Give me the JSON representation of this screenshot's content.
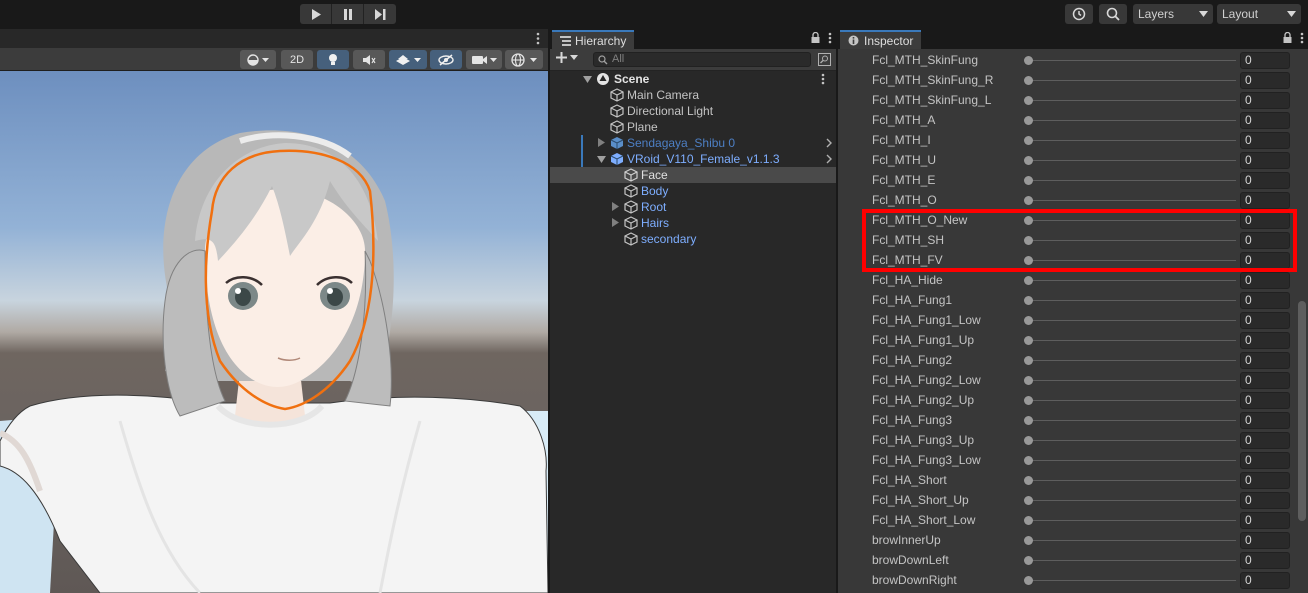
{
  "toolbar": {
    "layers_label": "Layers",
    "layout_label": "Layout"
  },
  "scene_tools": {
    "mode_2d": "2D"
  },
  "hierarchy": {
    "title": "Hierarchy",
    "search_placeholder": "All",
    "items": [
      {
        "label": "Scene",
        "depth": 0,
        "color": "#e4e4e4",
        "bold": true
      },
      {
        "label": "Main Camera",
        "depth": 1,
        "color": "#c4c4c4"
      },
      {
        "label": "Directional Light",
        "depth": 1,
        "color": "#c4c4c4"
      },
      {
        "label": "Plane",
        "depth": 1,
        "color": "#c4c4c4"
      },
      {
        "label": "Sendagaya_Shibu 0",
        "depth": 1,
        "color": "#4d7fc4"
      },
      {
        "label": "VRoid_V110_Female_v1.1.3",
        "depth": 1,
        "color": "#7eaeff"
      },
      {
        "label": "Face",
        "depth": 2,
        "color": "#c4c4c4"
      },
      {
        "label": "Body",
        "depth": 2,
        "color": "#7eaeff"
      },
      {
        "label": "Root",
        "depth": 2,
        "color": "#7eaeff"
      },
      {
        "label": "Hairs",
        "depth": 2,
        "color": "#7eaeff"
      },
      {
        "label": "secondary",
        "depth": 2,
        "color": "#7eaeff"
      }
    ]
  },
  "inspector": {
    "title": "Inspector",
    "rows": [
      {
        "name": "Fcl_MTH_SkinFung",
        "value": "0"
      },
      {
        "name": "Fcl_MTH_SkinFung_R",
        "value": "0"
      },
      {
        "name": "Fcl_MTH_SkinFung_L",
        "value": "0"
      },
      {
        "name": "Fcl_MTH_A",
        "value": "0"
      },
      {
        "name": "Fcl_MTH_I",
        "value": "0"
      },
      {
        "name": "Fcl_MTH_U",
        "value": "0"
      },
      {
        "name": "Fcl_MTH_E",
        "value": "0"
      },
      {
        "name": "Fcl_MTH_O",
        "value": "0"
      },
      {
        "name": "Fcl_MTH_O_New",
        "value": "0"
      },
      {
        "name": "Fcl_MTH_SH",
        "value": "0"
      },
      {
        "name": "Fcl_MTH_FV",
        "value": "0"
      },
      {
        "name": "Fcl_HA_Hide",
        "value": "0"
      },
      {
        "name": "Fcl_HA_Fung1",
        "value": "0"
      },
      {
        "name": "Fcl_HA_Fung1_Low",
        "value": "0"
      },
      {
        "name": "Fcl_HA_Fung1_Up",
        "value": "0"
      },
      {
        "name": "Fcl_HA_Fung2",
        "value": "0"
      },
      {
        "name": "Fcl_HA_Fung2_Low",
        "value": "0"
      },
      {
        "name": "Fcl_HA_Fung2_Up",
        "value": "0"
      },
      {
        "name": "Fcl_HA_Fung3",
        "value": "0"
      },
      {
        "name": "Fcl_HA_Fung3_Up",
        "value": "0"
      },
      {
        "name": "Fcl_HA_Fung3_Low",
        "value": "0"
      },
      {
        "name": "Fcl_HA_Short",
        "value": "0"
      },
      {
        "name": "Fcl_HA_Short_Up",
        "value": "0"
      },
      {
        "name": "Fcl_HA_Short_Low",
        "value": "0"
      },
      {
        "name": "browInnerUp",
        "value": "0"
      },
      {
        "name": "browDownLeft",
        "value": "0"
      },
      {
        "name": "browDownRight",
        "value": "0"
      }
    ]
  },
  "colors": {
    "accent_tab": "#3a79bb",
    "highlight": "#ff0000",
    "selection_outline": "#f07010"
  }
}
